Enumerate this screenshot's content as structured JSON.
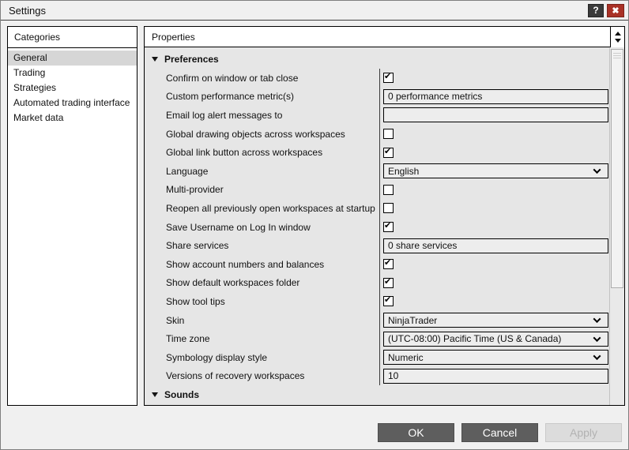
{
  "window": {
    "title": "Settings",
    "help_label": "?",
    "close_label": "✖"
  },
  "categories": {
    "header": "Categories",
    "items": [
      {
        "label": "General",
        "selected": true
      },
      {
        "label": "Trading",
        "selected": false
      },
      {
        "label": "Strategies",
        "selected": false
      },
      {
        "label": "Automated trading interface",
        "selected": false
      },
      {
        "label": "Market data",
        "selected": false
      }
    ]
  },
  "properties": {
    "header": "Properties",
    "rows": [
      {
        "type": "section",
        "label": "Preferences",
        "expanded": true
      },
      {
        "type": "checkbox",
        "label": "Confirm on window or tab close",
        "checked": true
      },
      {
        "type": "text",
        "label": "Custom performance metric(s)",
        "value": "0 performance metrics"
      },
      {
        "type": "text",
        "label": "Email log alert messages to",
        "value": ""
      },
      {
        "type": "checkbox",
        "label": "Global drawing objects across workspaces",
        "checked": false
      },
      {
        "type": "checkbox",
        "label": "Global link button across workspaces",
        "checked": true
      },
      {
        "type": "select",
        "label": "Language",
        "value": "English"
      },
      {
        "type": "checkbox",
        "label": "Multi-provider",
        "checked": false
      },
      {
        "type": "checkbox",
        "label": "Reopen all previously open workspaces at startup",
        "checked": false
      },
      {
        "type": "checkbox",
        "label": "Save Username on Log In window",
        "checked": true
      },
      {
        "type": "text",
        "label": "Share services",
        "value": "0 share services"
      },
      {
        "type": "checkbox",
        "label": "Show account numbers and balances",
        "checked": true
      },
      {
        "type": "checkbox",
        "label": "Show default workspaces folder",
        "checked": true
      },
      {
        "type": "checkbox",
        "label": "Show tool tips",
        "checked": true
      },
      {
        "type": "select",
        "label": "Skin",
        "value": "NinjaTrader"
      },
      {
        "type": "select",
        "label": "Time zone",
        "value": "(UTC-08:00) Pacific Time (US & Canada)"
      },
      {
        "type": "select",
        "label": "Symbology display style",
        "value": "Numeric"
      },
      {
        "type": "text",
        "label": "Versions of recovery workspaces",
        "value": "10"
      },
      {
        "type": "section",
        "label": "Sounds",
        "expanded": true
      }
    ]
  },
  "buttons": {
    "ok": "OK",
    "cancel": "Cancel",
    "apply": "Apply"
  },
  "colors": {
    "close_button_red": "#a93126",
    "dark_button_gray": "#5e5e5e",
    "disabled_button_bg": "#dcdcdc",
    "selection_gray": "#d6d6d6",
    "panel_content_bg": "#e6e6e6",
    "field_bg": "#ededed",
    "window_bg": "#f0f0f0"
  }
}
